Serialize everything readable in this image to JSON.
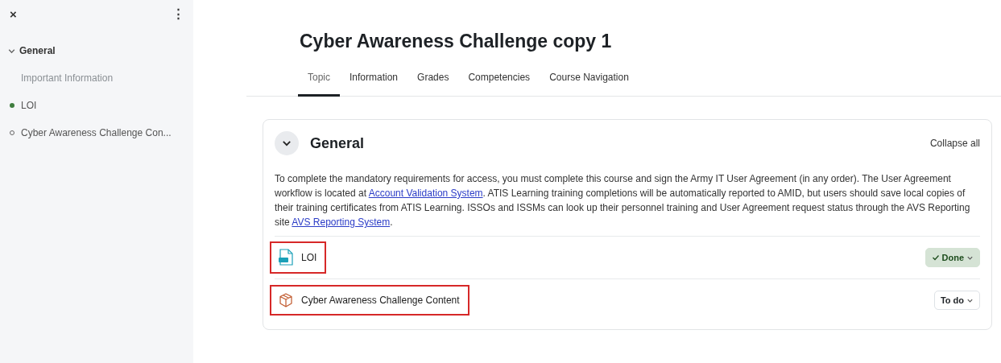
{
  "sidebar": {
    "close_label": "×",
    "menu_label": "⋮",
    "section": {
      "title": "General",
      "expanded": true
    },
    "items": [
      {
        "kind": "label",
        "label": "Important Information"
      },
      {
        "kind": "activity",
        "label": "LOI",
        "completed": true
      },
      {
        "kind": "activity",
        "label": "Cyber Awareness Challenge Con...",
        "completed": false
      }
    ]
  },
  "course": {
    "title": "Cyber Awareness Challenge copy 1",
    "tabs": [
      {
        "label": "Topic",
        "selected": true
      },
      {
        "label": "Information",
        "selected": false
      },
      {
        "label": "Grades",
        "selected": false
      },
      {
        "label": "Competencies",
        "selected": false
      },
      {
        "label": "Course Navigation",
        "selected": false
      }
    ]
  },
  "section": {
    "title": "General",
    "expanded": true,
    "collapse_all": "Collapse all",
    "description": [
      {
        "kind": "text",
        "text": "To complete the mandatory requirements for access, you must complete this course and sign the Army IT User Agreement (in any order).  The User Agreement workflow is located at "
      },
      {
        "kind": "link",
        "text": "Account Validation System"
      },
      {
        "kind": "text",
        "text": ". ATIS Learning training completions will be automatically reported to AMID, but users should save local copies of their training certificates from ATIS Learning. ISSOs and ISSMs can look up their personnel training and User Agreement request status through the AVS Reporting site "
      },
      {
        "kind": "link",
        "text": "AVS Reporting System"
      },
      {
        "kind": "text",
        "text": "."
      }
    ],
    "activities": [
      {
        "kind": "pdf",
        "name": "LOI",
        "highlighted": true,
        "status": "Done",
        "done": true
      },
      {
        "kind": "package",
        "name": "Cyber Awareness Challenge Content",
        "highlighted": true,
        "status": "To do",
        "done": false
      }
    ]
  }
}
